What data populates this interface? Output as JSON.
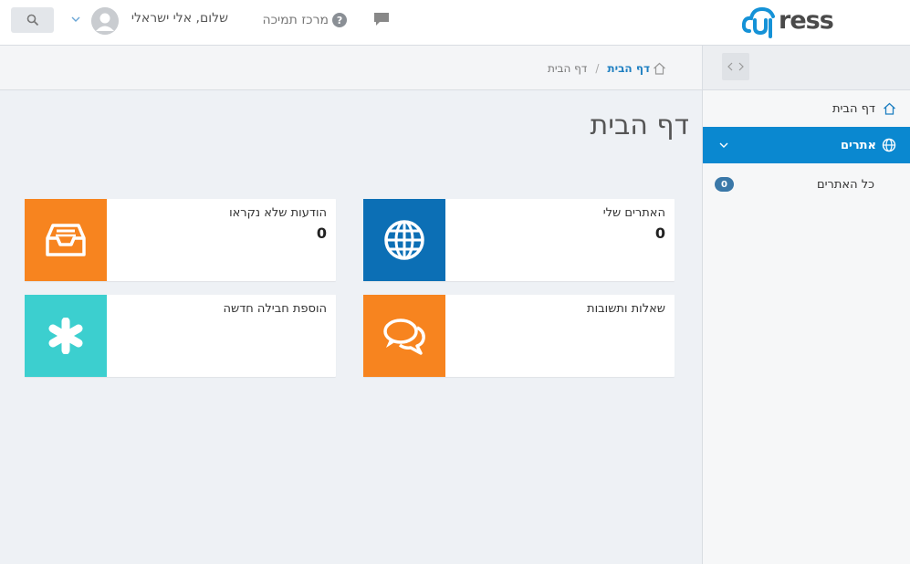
{
  "header": {
    "logo_text": "ress",
    "greeting": "שלום, אלי ישראלי",
    "support_label": "מרכז תמיכה",
    "support_icon": "question-circle-icon",
    "chat_icon": "chat-bubble-icon",
    "search_icon": "search-icon"
  },
  "breadcrumb": {
    "home_label": "דף הבית",
    "separator": "/",
    "current": "דף הבית"
  },
  "sidebar": {
    "home_label": "דף הבית",
    "sites_label": "אתרים",
    "all_sites_label": "כל האתרים",
    "all_sites_count": "0"
  },
  "main": {
    "title": "דף הבית",
    "cards": [
      {
        "label": "האתרים שלי",
        "count": "0",
        "color": "#0c6fb5",
        "icon": "globe-icon"
      },
      {
        "label": "הודעות שלא נקראו",
        "count": "0",
        "color": "#f7841f",
        "icon": "inbox-icon"
      },
      {
        "label": "שאלות ותשובות",
        "count": "",
        "color": "#f7841f",
        "icon": "chat-bubbles-icon"
      },
      {
        "label": "הוספת חבילה חדשה",
        "count": "",
        "color": "#3ccfcf",
        "icon": "asterisk-icon"
      }
    ]
  },
  "colors": {
    "accent": "#0a88d0",
    "orange": "#f7841f",
    "blue": "#0c6fb5",
    "teal": "#3ccfcf",
    "badge": "#3a78a8"
  }
}
